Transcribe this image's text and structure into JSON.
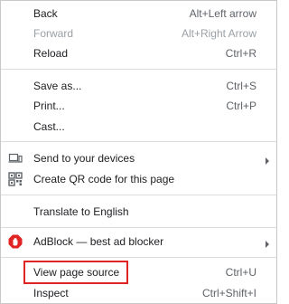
{
  "menu": {
    "items": [
      {
        "label": "Back",
        "shortcut": "Alt+Left arrow"
      },
      {
        "label": "Forward",
        "shortcut": "Alt+Right Arrow",
        "disabled": true
      },
      {
        "label": "Reload",
        "shortcut": "Ctrl+R"
      },
      {
        "label": "Save as...",
        "shortcut": "Ctrl+S"
      },
      {
        "label": "Print...",
        "shortcut": "Ctrl+P"
      },
      {
        "label": "Cast..."
      },
      {
        "label": "Send to your devices",
        "icon": "send-to-device-icon",
        "submenu": true
      },
      {
        "label": "Create QR code for this page",
        "icon": "qr-code-icon"
      },
      {
        "label": "Translate to English"
      },
      {
        "label": "AdBlock — best ad blocker",
        "icon": "adblock-hand-icon",
        "submenu": true
      },
      {
        "label": "View page source",
        "shortcut": "Ctrl+U",
        "highlighted": true
      },
      {
        "label": "Inspect",
        "shortcut": "Ctrl+Shift+I"
      }
    ]
  },
  "colors": {
    "highlight_border": "#e02424",
    "adblock_red": "#e02424",
    "disabled_text": "#9aa0a6"
  }
}
